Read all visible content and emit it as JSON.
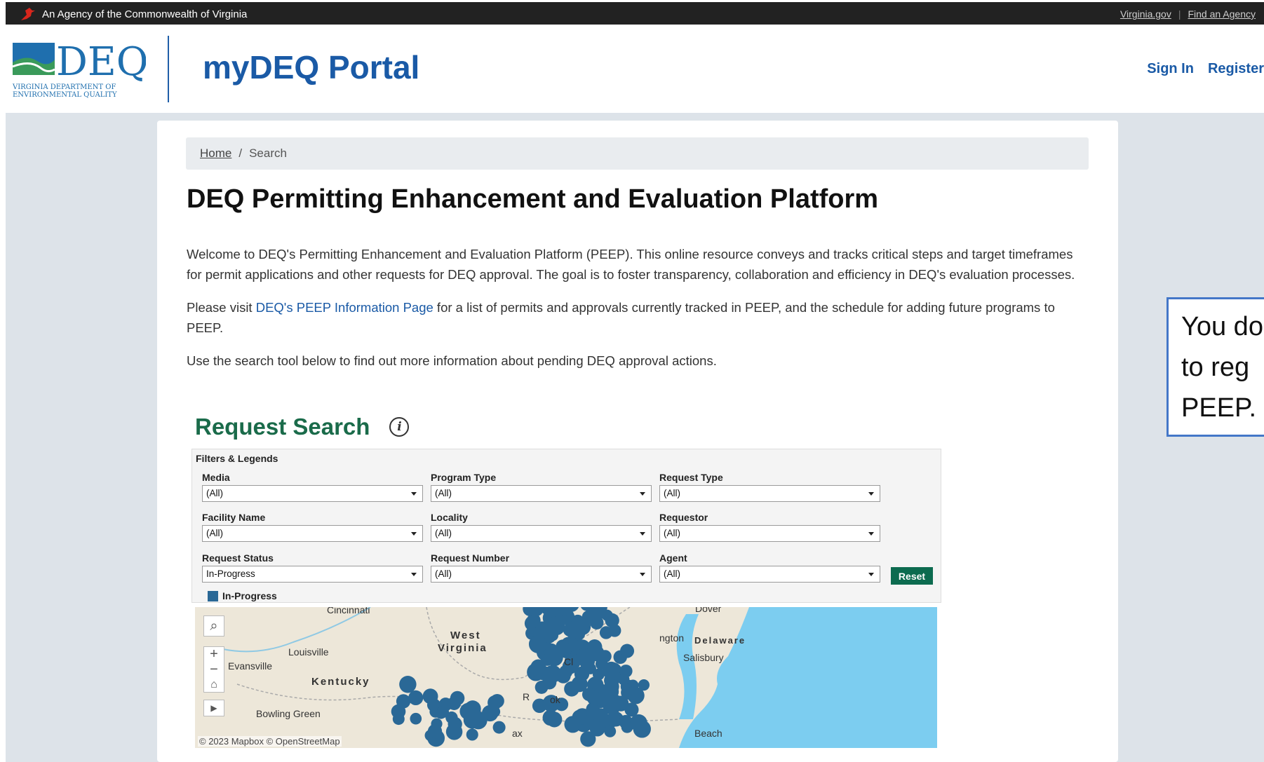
{
  "agency_bar": {
    "label": "An Agency of the Commonwealth of Virginia",
    "links": [
      "Virginia.gov",
      "Find an Agency"
    ]
  },
  "header": {
    "logo_text": "DEQ",
    "logo_subtext": "VIRGINIA DEPARTMENT OF ENVIRONMENTAL QUALITY",
    "portal_title": "myDEQ Portal",
    "sign_in": "Sign In",
    "register": "Register"
  },
  "breadcrumb": {
    "home": "Home",
    "separator": "/",
    "current": "Search"
  },
  "page_title": "DEQ Permitting Enhancement and Evaluation Platform",
  "intro": {
    "p1": "Welcome to DEQ's Permitting Enhancement and Evaluation Platform (PEEP). This online resource conveys and tracks critical steps and target timeframes for permit applications and other requests for DEQ approval. The goal is to foster transparency, collaboration and efficiency in DEQ's evaluation processes.",
    "p2_before": "Please visit ",
    "p2_link": "DEQ's PEEP Information Page",
    "p2_after": " for a list of permits and approvals currently tracked in PEEP, and the schedule for adding future programs to PEEP.",
    "p3": "Use the search tool below to find out more information about pending DEQ approval actions."
  },
  "search": {
    "heading": "Request Search",
    "info_icon": "i",
    "filters_title": "Filters & Legends",
    "filters": [
      {
        "label": "Media",
        "value": "(All)"
      },
      {
        "label": "Program Type",
        "value": "(All)"
      },
      {
        "label": "Request Type",
        "value": "(All)"
      },
      {
        "label": "Facility Name",
        "value": "(All)"
      },
      {
        "label": "Locality",
        "value": "(All)"
      },
      {
        "label": "Requestor",
        "value": "(All)"
      },
      {
        "label": "Request Status",
        "value": "In-Progress"
      },
      {
        "label": "Request Number",
        "value": "(All)"
      },
      {
        "label": "Agent",
        "value": "(All)"
      }
    ],
    "reset_label": "Reset",
    "legend_label": "In-Progress",
    "legend_color": "#2a6896"
  },
  "map": {
    "labels": {
      "cincinnati": "Cincinnati",
      "louisville": "Louisville",
      "evansville": "Evansville",
      "kentucky": "Kentucky",
      "bowling_green": "Bowling Green",
      "west_virginia_1": "West",
      "west_virginia_2": "Virginia",
      "dover": "Dover",
      "wilmington": "ngton",
      "delaware": "Delaware",
      "salisbury": "Salisbury",
      "beach": "Beach",
      "charlottesville": "Cl",
      "roanoke": "R",
      "roanoke2": "ok",
      "fairfax": "ax"
    },
    "attribution": "© 2023 Mapbox  © OpenStreetMap",
    "controls": {
      "search": "⌕",
      "zoom_in": "+",
      "zoom_out": "−",
      "home": "⌂",
      "play": "▶"
    },
    "point_color": "#2a6896",
    "water_color": "#7ccdf0"
  },
  "callout": {
    "line1": "You do",
    "line2": "to reg",
    "line3": "PEEP."
  }
}
